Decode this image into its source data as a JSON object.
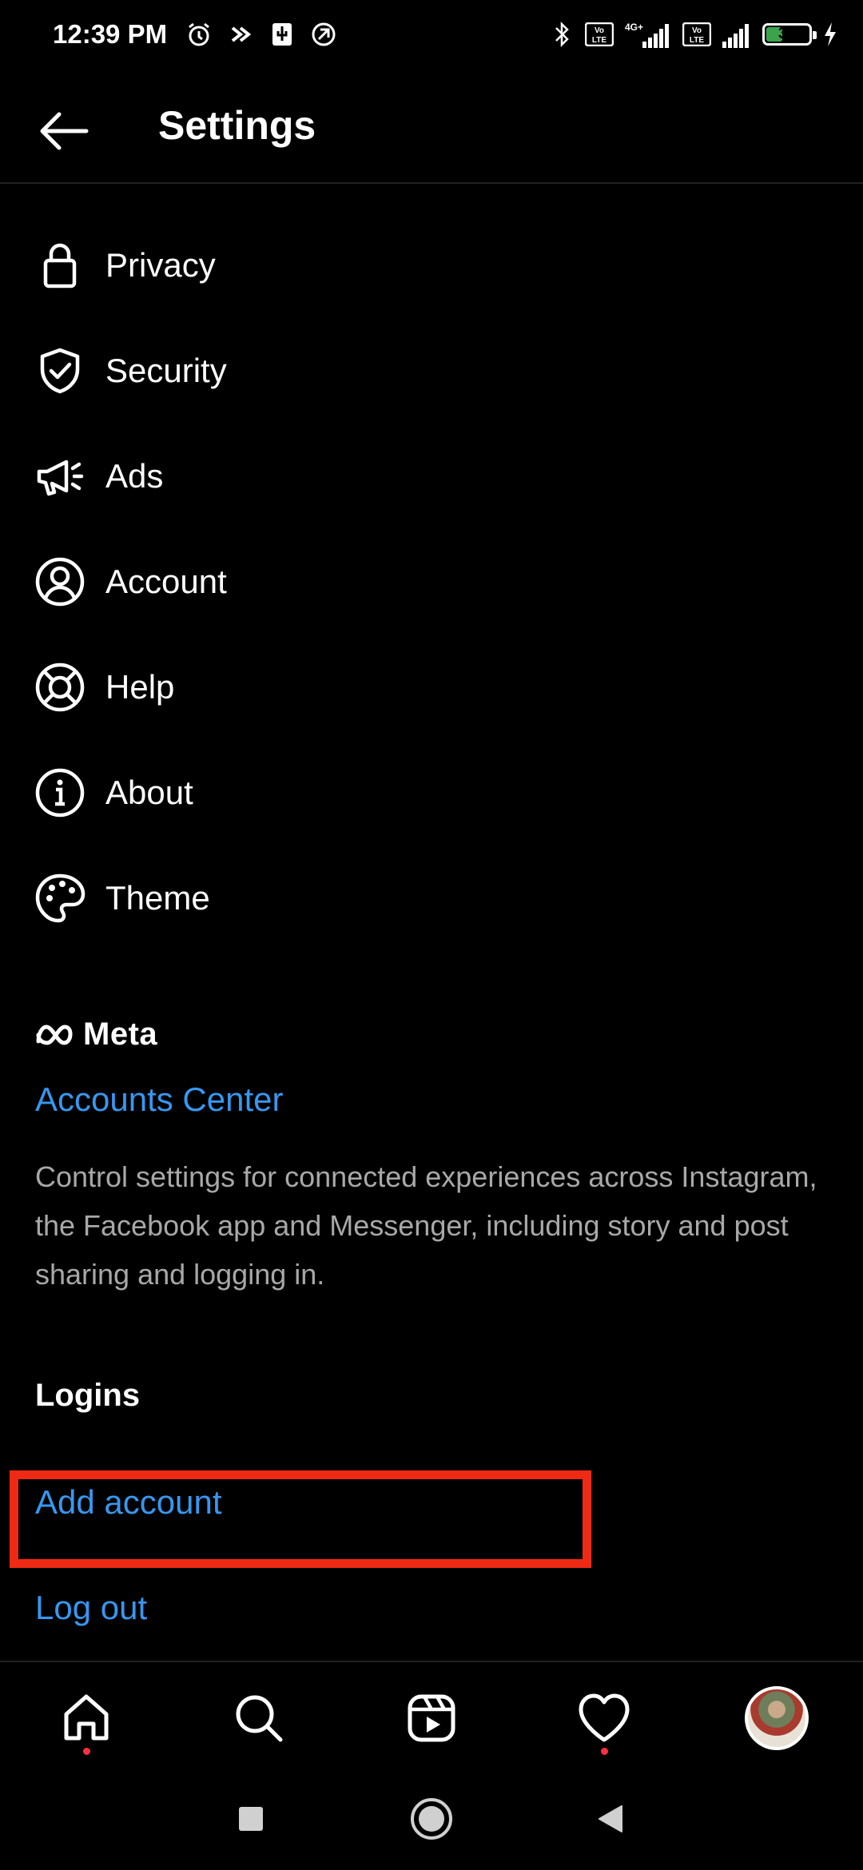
{
  "status_bar": {
    "time": "12:39 PM",
    "battery": "35",
    "network": "4G+",
    "volte_label": "Vo LTE"
  },
  "header": {
    "title": "Settings"
  },
  "menu": [
    {
      "label": "Privacy",
      "icon": "lock-icon"
    },
    {
      "label": "Security",
      "icon": "shield-check-icon"
    },
    {
      "label": "Ads",
      "icon": "megaphone-icon"
    },
    {
      "label": "Account",
      "icon": "user-circle-icon"
    },
    {
      "label": "Help",
      "icon": "lifebuoy-icon"
    },
    {
      "label": "About",
      "icon": "info-icon"
    },
    {
      "label": "Theme",
      "icon": "palette-icon"
    }
  ],
  "meta": {
    "logo_text": "Meta",
    "accounts_center": "Accounts Center",
    "description": "Control settings for connected experiences across Instagram, the Facebook app and Messenger, including story and post sharing and logging in."
  },
  "logins": {
    "section_title": "Logins",
    "add_account": "Add account",
    "log_out": "Log out"
  },
  "colors": {
    "background": "#000000",
    "link": "#3797f0",
    "highlight": "#ee2a14",
    "notification_dot": "#ff3040"
  },
  "tab_bar": [
    "home-icon",
    "search-icon",
    "reels-icon",
    "heart-icon",
    "profile-avatar"
  ]
}
